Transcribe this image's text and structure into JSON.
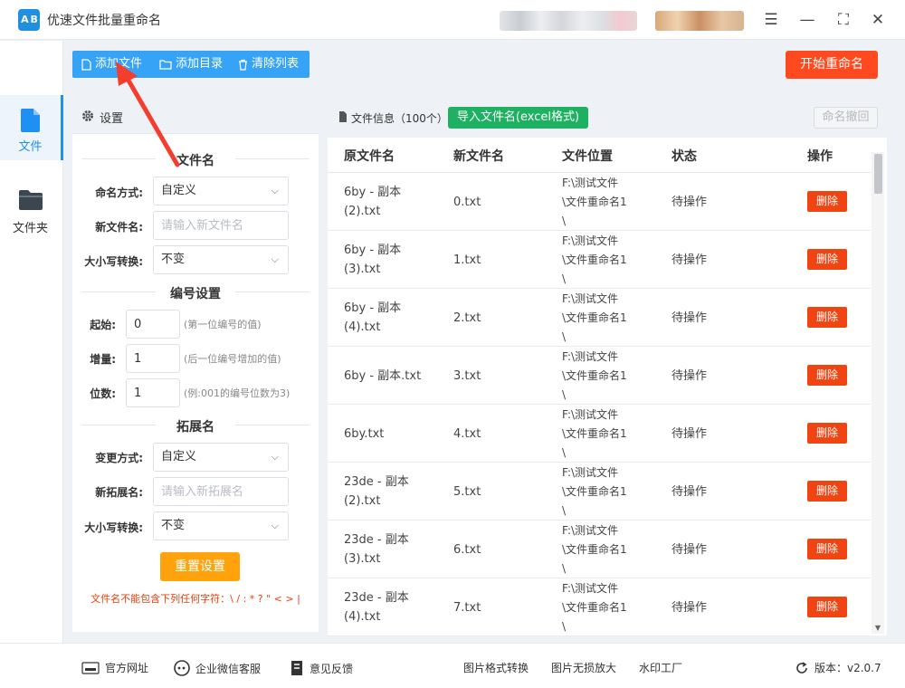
{
  "app": {
    "title": "优速文件批量重命名",
    "logo_text": "A B"
  },
  "window": {
    "menu_glyph": "☰",
    "minimize_glyph": "—",
    "maximize_glyph": "⛶",
    "close_glyph": "✕"
  },
  "sidebar": {
    "items": [
      {
        "label": "文件",
        "icon": "file-icon",
        "active": true
      },
      {
        "label": "文件夹",
        "icon": "folder-icon",
        "active": false
      }
    ]
  },
  "toolbar": {
    "add_file": "添加文件",
    "add_folder": "添加目录",
    "clear_list": "清除列表",
    "start": "开始重命名"
  },
  "settings": {
    "header": "设置",
    "filename_section": "文件名",
    "naming_mode_label": "命名方式:",
    "naming_mode_value": "自定义",
    "new_name_label": "新文件名:",
    "new_name_placeholder": "请输入新文件名",
    "case_label": "大小写转换:",
    "case_value": "不变",
    "numbering_section": "编号设置",
    "start_label": "起始:",
    "start_value": "0",
    "start_hint": "(第一位编号的值)",
    "step_label": "增量:",
    "step_value": "1",
    "step_hint": "(后一位编号增加的值)",
    "digits_label": "位数:",
    "digits_value": "1",
    "digits_hint": "(例:001的编号位数为3)",
    "ext_section": "拓展名",
    "ext_mode_label": "变更方式:",
    "ext_mode_value": "自定义",
    "new_ext_label": "新拓展名:",
    "new_ext_placeholder": "请输入新拓展名",
    "ext_case_label": "大小写转换:",
    "ext_case_value": "不变",
    "reset": "重置设置",
    "warning": "文件名不能包含下列任何字符：\\ / : * ? \" < > |"
  },
  "files": {
    "header": "文件信息（100个）",
    "import_button": "导入文件名(excel格式)",
    "undo_button": "命名撤回",
    "columns": [
      "原文件名",
      "新文件名",
      "文件位置",
      "状态",
      "操作"
    ],
    "delete_label": "删除",
    "rows": [
      {
        "original": [
          "6by - 副本",
          "(2).txt"
        ],
        "new": "0.txt",
        "location": [
          "F:\\测试文件",
          "\\文件重命名1",
          "\\"
        ],
        "status": "待操作"
      },
      {
        "original": [
          "6by - 副本",
          "(3).txt"
        ],
        "new": "1.txt",
        "location": [
          "F:\\测试文件",
          "\\文件重命名1",
          "\\"
        ],
        "status": "待操作"
      },
      {
        "original": [
          "6by - 副本",
          "(4).txt"
        ],
        "new": "2.txt",
        "location": [
          "F:\\测试文件",
          "\\文件重命名1",
          "\\"
        ],
        "status": "待操作"
      },
      {
        "original": [
          "6by - 副本.txt"
        ],
        "new": "3.txt",
        "location": [
          "F:\\测试文件",
          "\\文件重命名1",
          "\\"
        ],
        "status": "待操作"
      },
      {
        "original": [
          "6by.txt"
        ],
        "new": "4.txt",
        "location": [
          "F:\\测试文件",
          "\\文件重命名1",
          "\\"
        ],
        "status": "待操作"
      },
      {
        "original": [
          "23de - 副本",
          "(2).txt"
        ],
        "new": "5.txt",
        "location": [
          "F:\\测试文件",
          "\\文件重命名1",
          "\\"
        ],
        "status": "待操作"
      },
      {
        "original": [
          "23de - 副本",
          "(3).txt"
        ],
        "new": "6.txt",
        "location": [
          "F:\\测试文件",
          "\\文件重命名1",
          "\\"
        ],
        "status": "待操作"
      },
      {
        "original": [
          "23de - 副本",
          "(4).txt"
        ],
        "new": "7.txt",
        "location": [
          "F:\\测试文件",
          "\\文件重命名1",
          "\\"
        ],
        "status": "待操作"
      }
    ]
  },
  "footer": {
    "website": "官方网址",
    "wechat": "企业微信客服",
    "feedback": "意见反馈",
    "image_convert": "图片格式转换",
    "image_upscale": "图片无损放大",
    "watermark": "水印工厂",
    "version": "版本：v2.0.7"
  },
  "colors": {
    "accent": "#36a3f7",
    "start": "#ff4a1f",
    "import": "#1fb162",
    "reset": "#ffa20c",
    "delete": "#f04412",
    "annotation": "#f43d2d"
  }
}
